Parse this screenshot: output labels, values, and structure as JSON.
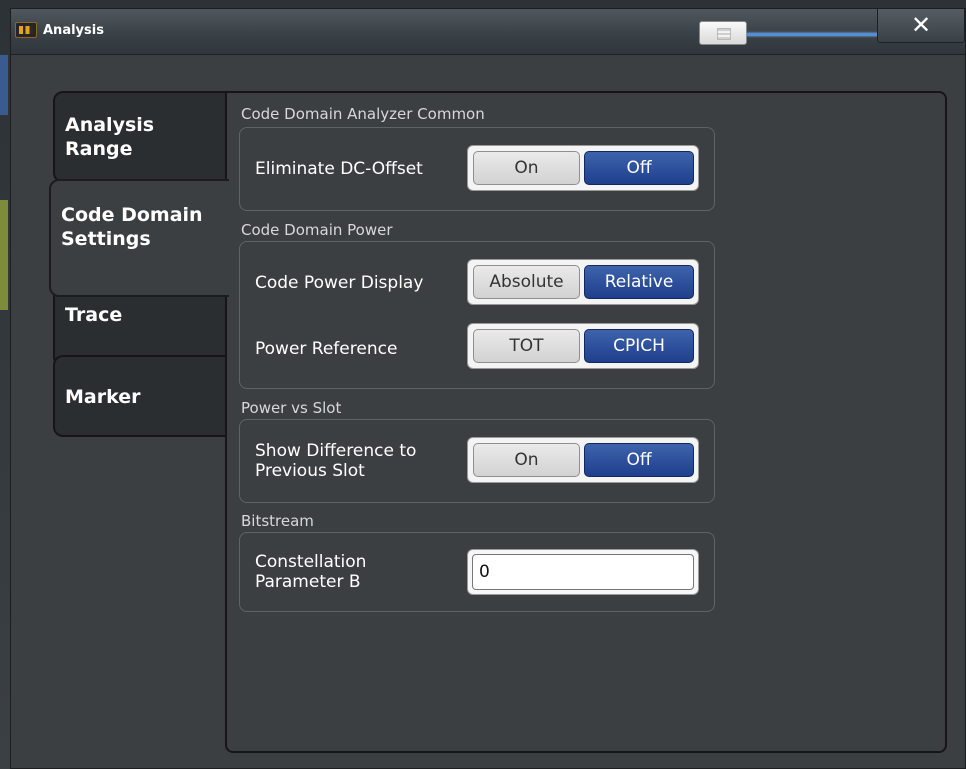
{
  "window": {
    "title": "Analysis",
    "close_label": "✕"
  },
  "tabs": [
    {
      "label": "Analysis Range"
    },
    {
      "label": "Code Domain Settings"
    },
    {
      "label": "Trace"
    },
    {
      "label": "Marker"
    }
  ],
  "sections": {
    "common": {
      "title": "Code Domain Analyzer Common",
      "eliminate_dc": {
        "label": "Eliminate DC-Offset",
        "option_a": "On",
        "option_b": "Off",
        "selected": "Off"
      }
    },
    "cdp": {
      "title": "Code Domain Power",
      "display": {
        "label": "Code Power Display",
        "option_a": "Absolute",
        "option_b": "Relative",
        "selected": "Relative"
      },
      "reference": {
        "label": "Power Reference",
        "option_a": "TOT",
        "option_b": "CPICH",
        "selected": "CPICH"
      }
    },
    "slot": {
      "title": "Power vs Slot",
      "show_diff": {
        "label": "Show Difference to Previous Slot",
        "option_a": "On",
        "option_b": "Off",
        "selected": "Off"
      }
    },
    "bitstream": {
      "title": "Bitstream",
      "constellation": {
        "label": "Constellation Parameter B",
        "value": "0"
      }
    }
  },
  "colors": {
    "selected_blue": "#1f3f8c",
    "panel_bg": "#3c3f41"
  }
}
